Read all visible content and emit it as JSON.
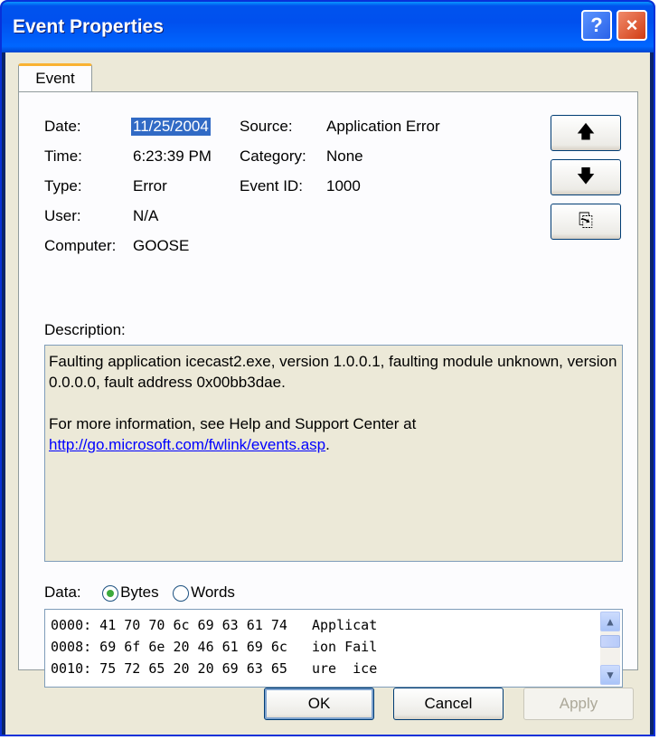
{
  "window": {
    "title": "Event Properties",
    "help_glyph": "?",
    "close_glyph": "×"
  },
  "tabs": [
    {
      "label": "Event"
    }
  ],
  "fields": {
    "date_label": "Date:",
    "date_value": "11/25/2004",
    "time_label": "Time:",
    "time_value": "6:23:39 PM",
    "type_label": "Type:",
    "type_value": "Error",
    "user_label": "User:",
    "user_value": "N/A",
    "computer_label": "Computer:",
    "computer_value": "GOOSE",
    "source_label": "Source:",
    "source_value": "Application Error",
    "category_label": "Category:",
    "category_value": "None",
    "eventid_label": "Event ID:",
    "eventid_value": "1000"
  },
  "side_buttons": {
    "up_glyph": "🡅",
    "down_glyph": "🡇",
    "copy_glyph": "⎘"
  },
  "description": {
    "label": "Description:",
    "line1": "Faulting application icecast2.exe, version 1.0.0.1, faulting module unknown, version 0.0.0.0, fault address 0x00bb3dae.",
    "line2": "For more information, see Help and Support Center at",
    "link": "http://go.microsoft.com/fwlink/events.asp",
    "link_suffix": "."
  },
  "data": {
    "label": "Data:",
    "option_bytes": "Bytes",
    "option_words": "Words",
    "selected": "Bytes",
    "rows": [
      "0000: 41 70 70 6c 69 63 61 74   Applicat",
      "0008: 69 6f 6e 20 46 61 69 6c   ion Fail",
      "0010: 75 72 65 20 20 69 63 65   ure  ice"
    ]
  },
  "buttons": {
    "ok": "OK",
    "cancel": "Cancel",
    "apply": "Apply"
  }
}
